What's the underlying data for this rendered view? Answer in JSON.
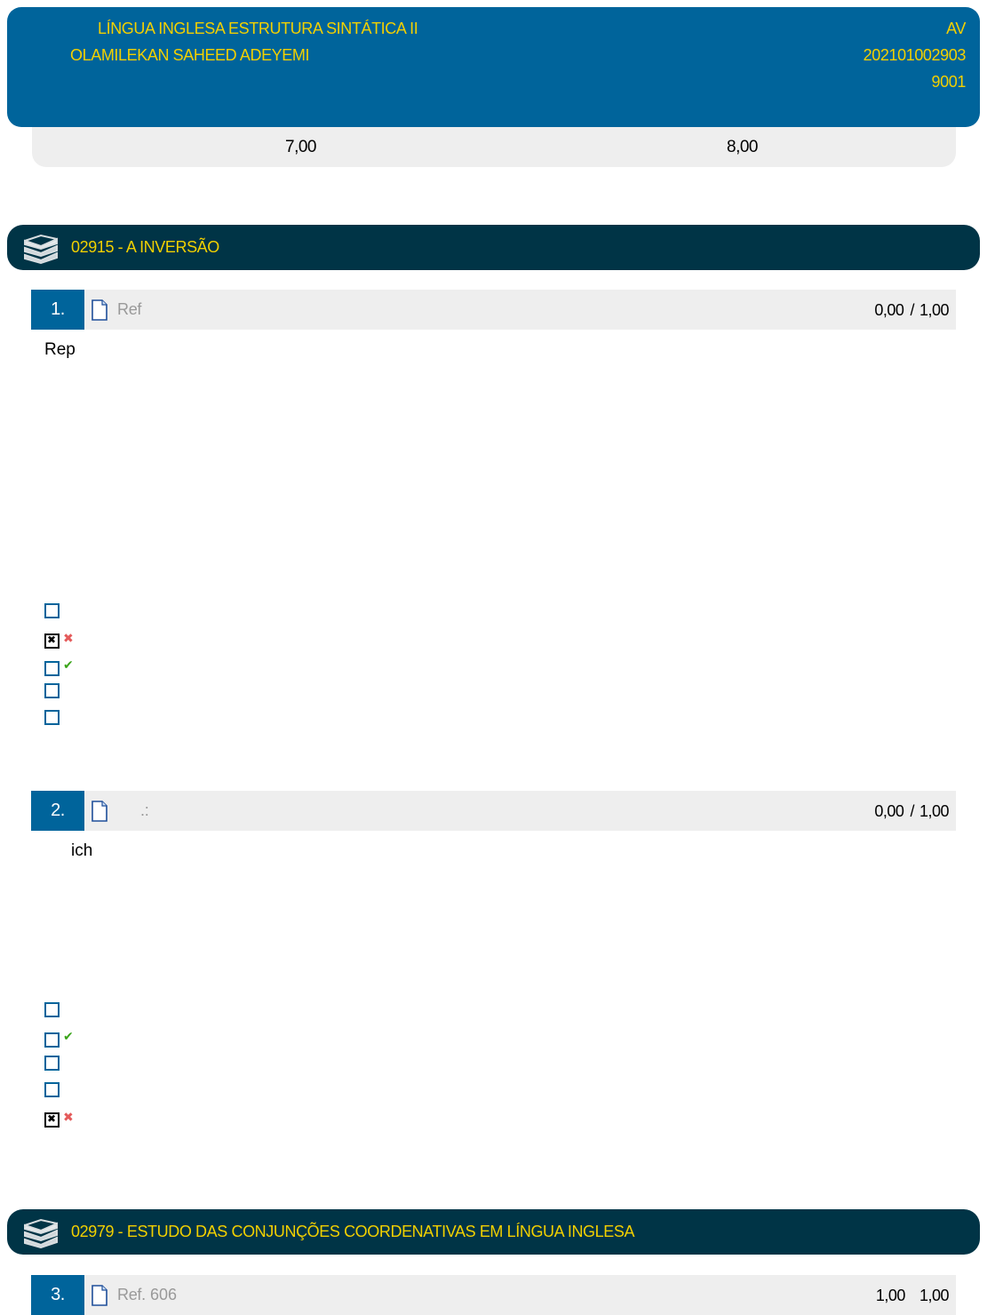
{
  "header": {
    "course": "LÍNGUA INGLESA ESTRUTURA SINTÁTICA II",
    "student": "OLAMILEKAN SAHEED ADEYEMI",
    "type": "AV",
    "enrollment": "202101002903",
    "class": "9001"
  },
  "scores": {
    "left": "7,00",
    "right": "8,00"
  },
  "colors": {
    "header_bg": "#00649b",
    "topic_bg": "#003446",
    "accent_text": "#f2d000"
  },
  "topics": [
    {
      "title": "02915 - A INVERSÃO",
      "icon": "books-icon"
    },
    {
      "title": "02979 - ESTUDO DAS CONJUNÇÕES COORDENATIVAS EM LÍNGUA INGLESA",
      "icon": "books-icon"
    }
  ],
  "questions": [
    {
      "number": "1.",
      "ref": "Ref",
      "score": "0,00",
      "sep": "/",
      "max": "1,00",
      "text": "Rep",
      "options": [
        "empty",
        "selected-wrong",
        "correct",
        "empty",
        "empty"
      ]
    },
    {
      "number": "2.",
      "ref": ".:",
      "score": "0,00",
      "sep": "/",
      "max": "1,00",
      "text": "ich",
      "options": [
        "empty",
        "correct",
        "empty",
        "empty",
        "selected-wrong"
      ]
    },
    {
      "number": "3.",
      "ref": "Ref.",
      "ref_num": "606",
      "score": "1,00",
      "max": "1,00"
    }
  ]
}
